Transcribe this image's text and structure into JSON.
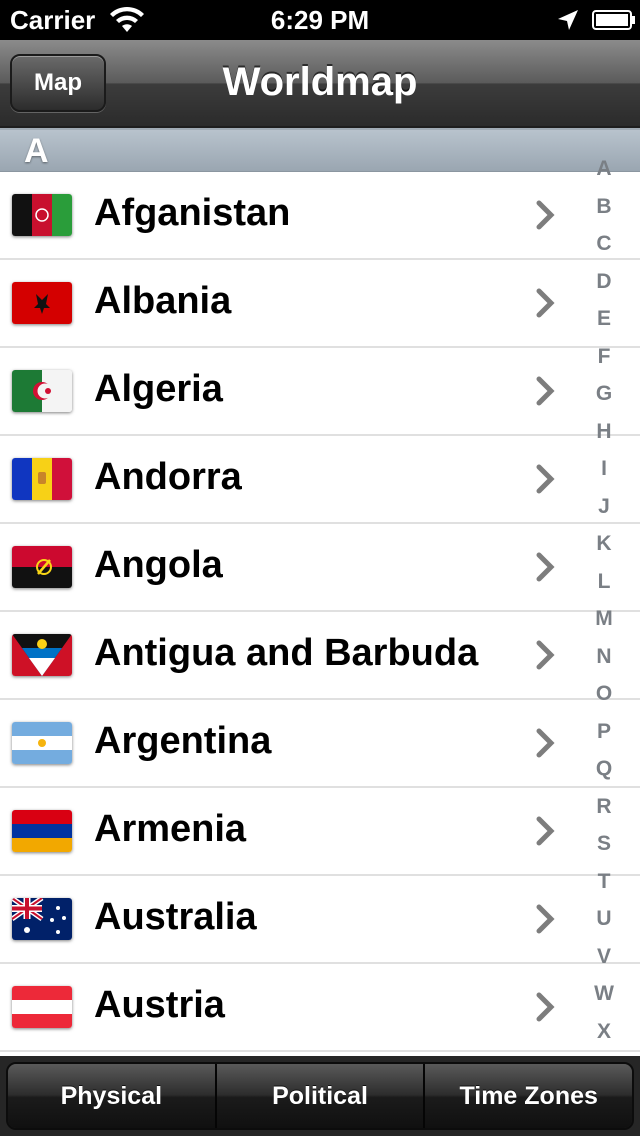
{
  "status_bar": {
    "carrier": "Carrier",
    "time": "6:29 PM",
    "icons": [
      "wifi-icon",
      "location-arrow-icon",
      "battery-icon"
    ]
  },
  "nav": {
    "back_label": "Map",
    "title": "Worldmap"
  },
  "section": {
    "letter": "A"
  },
  "countries": [
    {
      "name": "Afganistan",
      "flag": "afghanistan-flag-icon"
    },
    {
      "name": "Albania",
      "flag": "albania-flag-icon"
    },
    {
      "name": "Algeria",
      "flag": "algeria-flag-icon"
    },
    {
      "name": "Andorra",
      "flag": "andorra-flag-icon"
    },
    {
      "name": "Angola",
      "flag": "angola-flag-icon"
    },
    {
      "name": "Antigua and Barbuda",
      "flag": "antigua-flag-icon"
    },
    {
      "name": "Argentina",
      "flag": "argentina-flag-icon"
    },
    {
      "name": "Armenia",
      "flag": "armenia-flag-icon"
    },
    {
      "name": "Australia",
      "flag": "australia-flag-icon"
    },
    {
      "name": "Austria",
      "flag": "austria-flag-icon"
    }
  ],
  "index": [
    "A",
    "B",
    "C",
    "D",
    "E",
    "F",
    "G",
    "H",
    "I",
    "J",
    "K",
    "L",
    "M",
    "N",
    "O",
    "P",
    "Q",
    "R",
    "S",
    "T",
    "U",
    "V",
    "W",
    "X"
  ],
  "tabs": [
    {
      "label": "Physical"
    },
    {
      "label": "Political"
    },
    {
      "label": "Time Zones"
    }
  ]
}
